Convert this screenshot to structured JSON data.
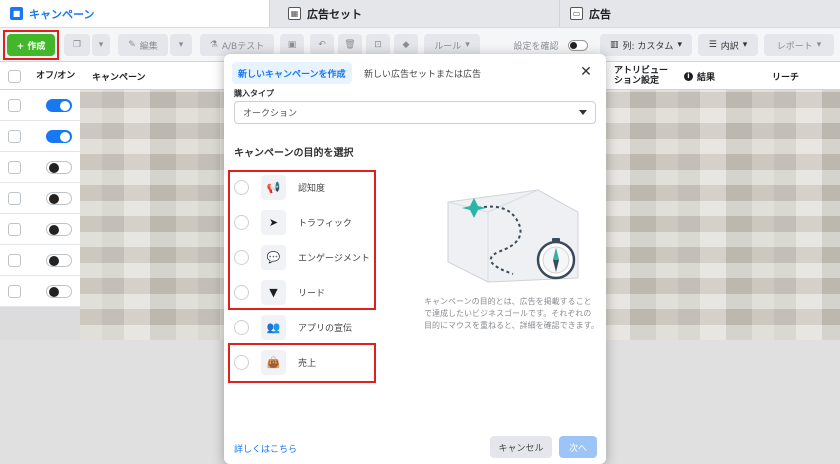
{
  "tabs": [
    {
      "label": "キャンペーン",
      "icon": "folder-icon"
    },
    {
      "label": "広告セット",
      "icon": "adset-grid-icon"
    },
    {
      "label": "広告",
      "icon": "ad-page-icon"
    }
  ],
  "toolbar": {
    "create_label": "+ 作成",
    "edit_label": "編集",
    "ab_test_label": "A/Bテスト",
    "rules_label": "ルール",
    "view_setup_label": "設定を確認",
    "columns_label": "列: カスタム",
    "breakdown_label": "内訳",
    "reports_label": "レポート"
  },
  "table": {
    "col_onoff": "オフ/オン",
    "col_campaign": "キャンペーン",
    "col_attribution": "アトリビューション設定",
    "col_results": "結果",
    "col_reach": "リーチ",
    "rows": [
      {
        "on": true
      },
      {
        "on": true
      },
      {
        "on": false
      },
      {
        "on": false
      },
      {
        "on": false
      },
      {
        "on": false
      },
      {
        "on": false
      }
    ]
  },
  "modal": {
    "tab_new_campaign": "新しいキャンペーンを作成",
    "tab_new_adset": "新しい広告セットまたは広告",
    "close_symbol": "✕",
    "buying_type_label": "購入タイプ",
    "buying_type_value": "オークション",
    "objective_title": "キャンペーンの目的を選択",
    "objectives": [
      {
        "label": "認知度",
        "icon": "megaphone-icon",
        "glyph": "📢"
      },
      {
        "label": "トラフィック",
        "icon": "cursor-icon",
        "glyph": "➤"
      },
      {
        "label": "エンゲージメント",
        "icon": "chat-bubbles-icon",
        "glyph": "💬"
      },
      {
        "label": "リード",
        "icon": "funnel-icon",
        "glyph": "▼"
      },
      {
        "label": "アプリの宣伝",
        "icon": "people-icon",
        "glyph": "👥"
      },
      {
        "label": "売上",
        "icon": "shopping-bag-icon",
        "glyph": "👜"
      }
    ],
    "description": "キャンペーンの目的とは、広告を掲載することで達成したいビジネスゴールです。それぞれの目的にマウスを重ねると、詳細を確認できます。",
    "learn_more": "詳しくはこちら",
    "cancel_label": "キャンセル",
    "next_label": "次へ"
  },
  "colors": {
    "accent": "#1877f2",
    "create_green": "#42b72a",
    "highlight_red": "#e0201f"
  }
}
